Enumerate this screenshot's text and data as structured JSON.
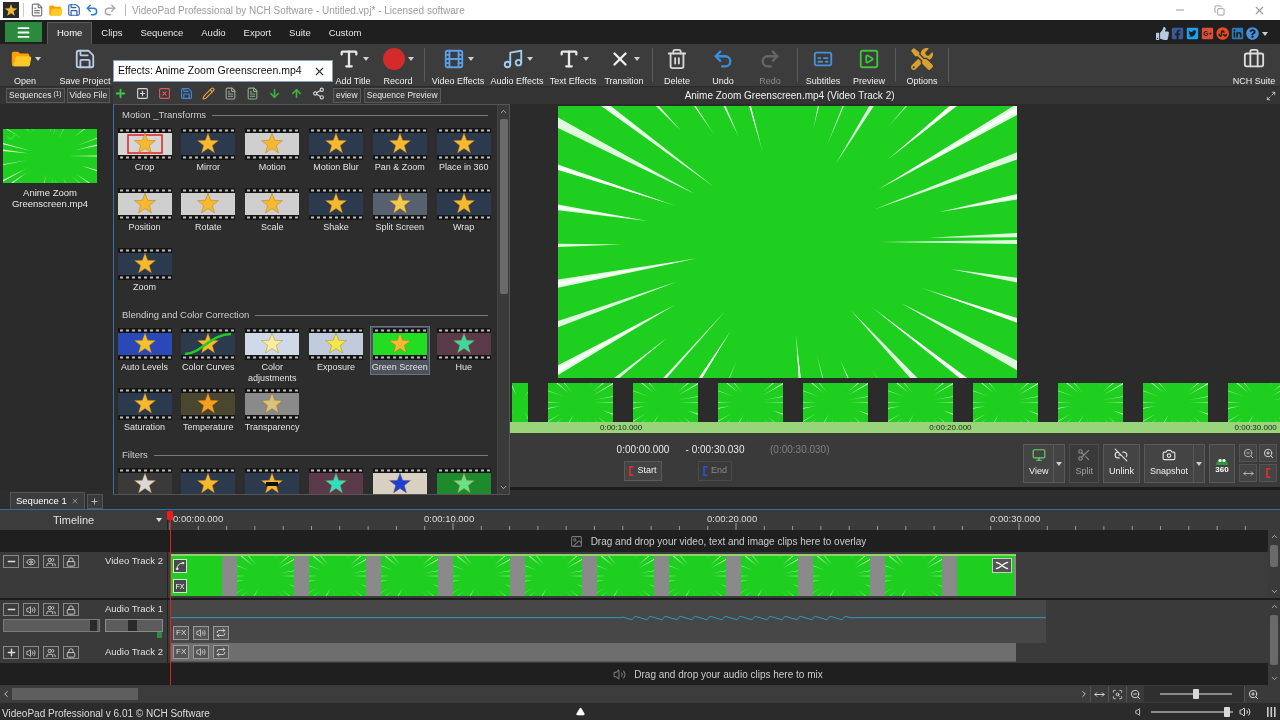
{
  "window": {
    "title": "VideoPad Professional by NCH Software - Untitled.vpj* - Licensed software"
  },
  "menu_tabs": [
    {
      "label": "Home",
      "selected": true
    },
    {
      "label": "Clips",
      "selected": false
    },
    {
      "label": "Sequence",
      "selected": false
    },
    {
      "label": "Audio",
      "selected": false
    },
    {
      "label": "Export",
      "selected": false
    },
    {
      "label": "Suite",
      "selected": false
    },
    {
      "label": "Custom",
      "selected": false
    }
  ],
  "toolbar": [
    {
      "label": "Open",
      "dropdown": true,
      "disabled": false
    },
    {
      "label": "Save Project",
      "dropdown": false,
      "disabled": false
    },
    {
      "label": "Add Title",
      "dropdown": true,
      "disabled": false
    },
    {
      "label": "Record",
      "dropdown": true,
      "disabled": false
    },
    {
      "label": "Video Effects",
      "dropdown": true,
      "disabled": false
    },
    {
      "label": "Audio Effects",
      "dropdown": true,
      "disabled": false
    },
    {
      "label": "Text Effects",
      "dropdown": true,
      "disabled": false
    },
    {
      "label": "Transition",
      "dropdown": true,
      "disabled": false
    },
    {
      "label": "Delete",
      "dropdown": false,
      "disabled": false
    },
    {
      "label": "Undo",
      "dropdown": false,
      "disabled": false
    },
    {
      "label": "Redo",
      "dropdown": false,
      "disabled": true
    },
    {
      "label": "Subtitles",
      "dropdown": false,
      "disabled": false
    },
    {
      "label": "Preview",
      "dropdown": false,
      "disabled": false
    },
    {
      "label": "Options",
      "dropdown": false,
      "disabled": false
    },
    {
      "label": "NCH Suite",
      "dropdown": false,
      "disabled": false
    }
  ],
  "panel_tabs": [
    {
      "label": "Sequences",
      "count": "(1)"
    },
    {
      "label": "Video File"
    },
    {
      "label": "eview"
    },
    {
      "label": "Sequence Preview"
    }
  ],
  "bin": {
    "clips": [
      {
        "name": "Anime Zoom Greenscreen.mp4"
      }
    ]
  },
  "effects_popup": {
    "title": "Effects: Anime Zoom Greenscreen.mp4",
    "categories": [
      {
        "title": "Motion _Transforms",
        "items": [
          {
            "label": "Crop",
            "selected": false
          },
          {
            "label": "Mirror",
            "selected": false
          },
          {
            "label": "Motion",
            "selected": false
          },
          {
            "label": "Motion Blur",
            "selected": false
          },
          {
            "label": "Pan & Zoom",
            "selected": false
          },
          {
            "label": "Place in 360",
            "selected": false
          },
          {
            "label": "Position",
            "selected": false
          },
          {
            "label": "Rotate",
            "selected": false
          },
          {
            "label": "Scale",
            "selected": false
          },
          {
            "label": "Shake",
            "selected": false
          },
          {
            "label": "Split Screen",
            "selected": false
          },
          {
            "label": "Wrap",
            "selected": false
          },
          {
            "label": "Zoom",
            "selected": false
          }
        ]
      },
      {
        "title": "Blending and Color Correction",
        "items": [
          {
            "label": "Auto Levels",
            "selected": false
          },
          {
            "label": "Color Curves",
            "selected": false
          },
          {
            "label": "Color adjustments",
            "selected": false
          },
          {
            "label": "Exposure",
            "selected": false
          },
          {
            "label": "Green Screen",
            "selected": true
          },
          {
            "label": "Hue",
            "selected": false
          },
          {
            "label": "Saturation",
            "selected": false
          },
          {
            "label": "Temperature",
            "selected": false
          },
          {
            "label": "Transparency",
            "selected": false
          }
        ]
      },
      {
        "title": "Filters",
        "items": [
          {
            "selected": false
          },
          {
            "selected": false
          },
          {
            "selected": false
          },
          {
            "selected": false
          },
          {
            "selected": false
          },
          {
            "selected": false
          }
        ]
      }
    ]
  },
  "preview": {
    "title": "Anime Zoom Greenscreen.mp4 (Video Track 2)",
    "ruler": [
      "0:00:10.000",
      "0:00:20.000",
      "0:00:30.000"
    ],
    "start_time": "0:00:00.000",
    "end_time": "- 0:00:30.030",
    "duration": "(0:00:30.030)",
    "mark_buttons": [
      {
        "label": "Start",
        "disabled": false
      },
      {
        "label": "End",
        "disabled": true
      }
    ],
    "tools": [
      {
        "label": "View",
        "dropdown": true,
        "disabled": false
      },
      {
        "label": "Split",
        "dropdown": false,
        "disabled": true
      },
      {
        "label": "Unlink",
        "dropdown": false,
        "disabled": false
      },
      {
        "label": "Snapshot",
        "dropdown": true,
        "disabled": false
      }
    ],
    "vr_label": "360"
  },
  "sequence_tabs": [
    {
      "label": "Sequence 1",
      "selected": true
    }
  ],
  "timeline": {
    "title": "Timeline",
    "ruler": [
      "0:00:00.000",
      "0:00:10.000",
      "0:00:20.000",
      "0:00:30.000"
    ],
    "overlay_hint": "Drag and drop your video, text and image clips here to overlay",
    "tracks": [
      {
        "name": "Video Track 2",
        "kind": "video",
        "expanded": true,
        "fx": "FX"
      },
      {
        "name": "Audio Track 1",
        "kind": "audio",
        "expanded": true,
        "fx": "FX",
        "volume": {
          "level": 0.95
        },
        "pan": {
          "level": 0.45
        }
      },
      {
        "name": "Audio Track 2",
        "kind": "audio",
        "expanded": false,
        "fx": "FX"
      }
    ],
    "audio_hint": "Drag and drop your audio clips here to mix",
    "zoom": {
      "level": 0.5
    }
  },
  "status_bar": {
    "text": "VideoPad Professional v 6.01 © NCH Software",
    "volume": {
      "level": 0.96
    }
  }
}
